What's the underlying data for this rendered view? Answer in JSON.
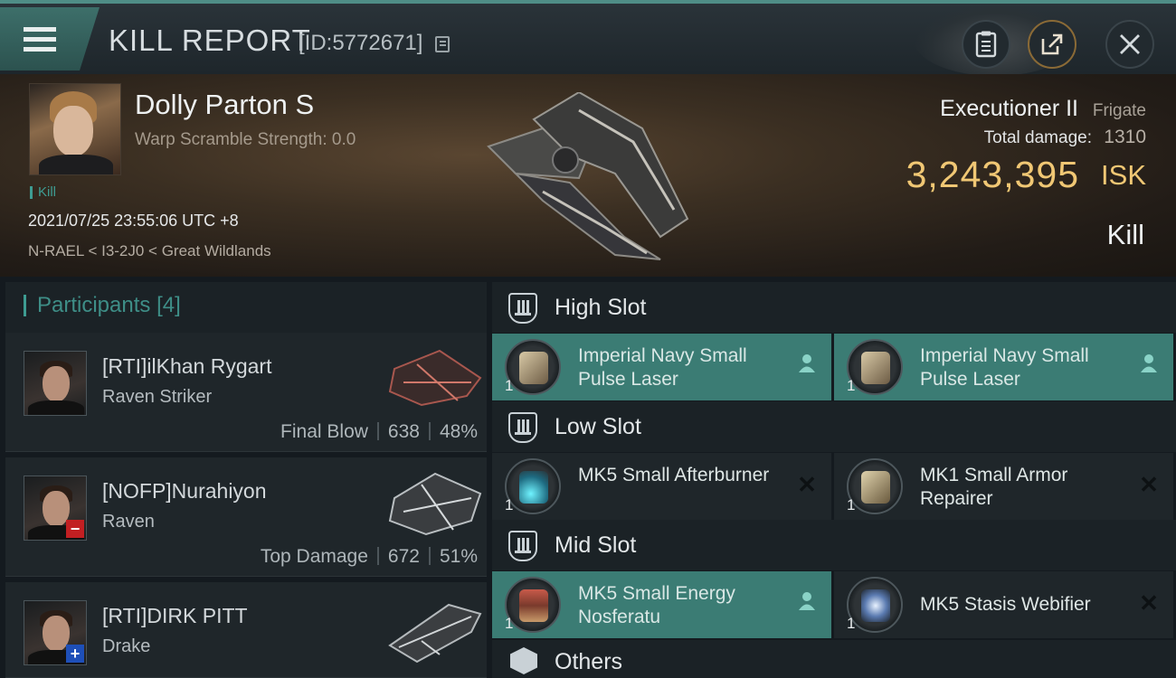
{
  "header": {
    "title": "KILL REPORT",
    "report_id": "[ID:5772671]"
  },
  "victim": {
    "name": "Dolly Parton S",
    "scramble": "Warp Scramble Strength: 0.0",
    "kill_tag": "Kill",
    "datetime": "2021/07/25 23:55:06 UTC +8",
    "location": "N-RAEL < I3-2J0 < Great Wildlands",
    "ship_name": "Executioner II",
    "ship_class": "Frigate",
    "total_damage_label": "Total damage:",
    "total_damage": "1310",
    "isk_value": "3,243,395",
    "isk_unit": "ISK",
    "status": "Kill"
  },
  "participants": {
    "title": "Participants",
    "count": "[4]",
    "rows": [
      {
        "name": "[RTI]ilKhan Rygart",
        "ship": "Raven Striker",
        "tag": "Final Blow",
        "damage": "638",
        "percent": "48%"
      },
      {
        "name": "[NOFP]Nurahiyon",
        "ship": "Raven",
        "tag": "Top Damage",
        "damage": "672",
        "percent": "51%"
      },
      {
        "name": "[RTI]DIRK PITT",
        "ship": "Drake"
      }
    ]
  },
  "fitting": {
    "high_slot": {
      "label": "High Slot",
      "modules": [
        {
          "qty": "1",
          "name": "Imperial Navy Small Pulse Laser",
          "state": "fitted"
        },
        {
          "qty": "1",
          "name": "Imperial Navy Small Pulse Laser",
          "state": "fitted"
        }
      ]
    },
    "low_slot": {
      "label": "Low Slot",
      "modules": [
        {
          "qty": "1",
          "name": "MK5 Small Afterburner",
          "state": "destroyed"
        },
        {
          "qty": "1",
          "name": "MK1 Small Armor Repairer",
          "state": "destroyed"
        }
      ]
    },
    "mid_slot": {
      "label": "Mid Slot",
      "modules": [
        {
          "qty": "1",
          "name": "MK5 Small Energy Nosferatu",
          "state": "fitted"
        },
        {
          "qty": "1",
          "name": "MK5 Stasis Webifier",
          "state": "destroyed"
        }
      ]
    },
    "others": {
      "label": "Others"
    }
  },
  "colors": {
    "accent": "#3e9c92",
    "isk": "#f0c774",
    "module_active": "#3b7c74"
  }
}
